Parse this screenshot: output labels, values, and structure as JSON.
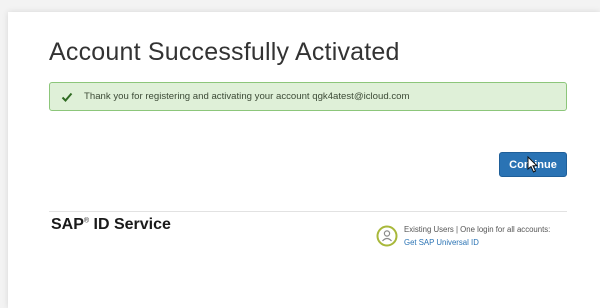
{
  "page": {
    "title": "Account Successfully Activated"
  },
  "alert": {
    "icon": "checkmark-icon",
    "message": "Thank you for registering and activating your account qgk4atest@icloud.com",
    "background": "#dff0d8",
    "border": "#8cc67a"
  },
  "actions": {
    "continue_label": "Continue",
    "button_color": "#2a73b4"
  },
  "footer": {
    "brand_name": "SAP",
    "brand_mark": "®",
    "brand_service": " ID Service",
    "universal_id_icon": "universal-id-icon",
    "existing_users_text": "Existing Users | One login for all accounts:",
    "universal_id_link": "Get SAP Universal ID"
  },
  "overlay": {
    "cursor_icon": "mouse-cursor-icon"
  }
}
